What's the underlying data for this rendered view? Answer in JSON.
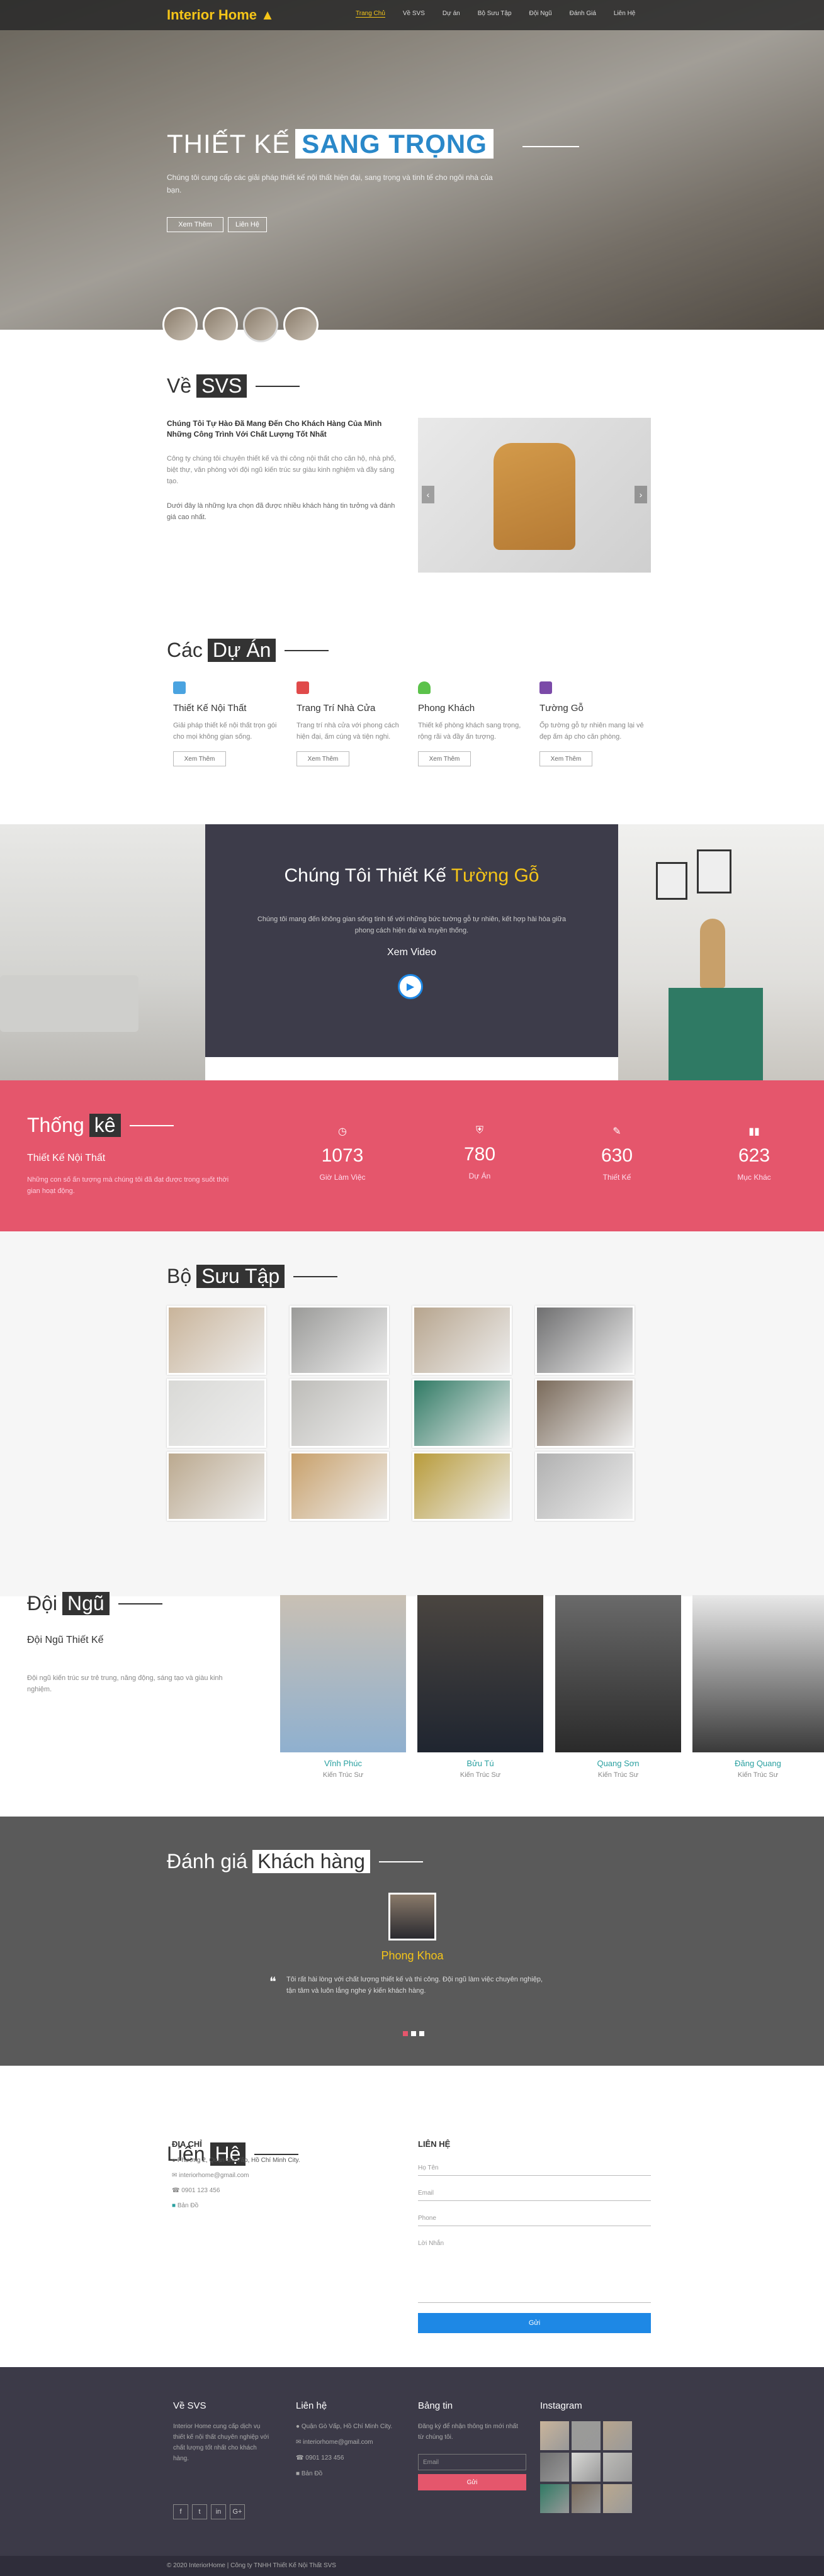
{
  "header": {
    "logo": "Interior Home",
    "nav": [
      "Trang Chủ",
      "Về SVS",
      "Dự án",
      "Bộ Sưu Tập",
      "Đội Ngũ",
      "Đánh Giá",
      "Liên Hệ"
    ]
  },
  "hero": {
    "title_plain": "THIẾT KẾ",
    "title_highlight": "SANG TRỌNG",
    "subtitle": "Chúng tôi cung cấp các giải pháp thiết kế nội thất hiện đại, sang trọng và tinh tế cho ngôi nhà của bạn.",
    "btn_more": "Xem Thêm",
    "btn_contact": "Liên Hệ"
  },
  "about": {
    "title_plain": "Về",
    "title_highlight": "SVS",
    "heading": "Chúng Tôi Tự Hào Đã Mang Đến Cho Khách Hàng Của Mình Những Công Trình Với Chất Lượng Tốt Nhất",
    "text1": "Công ty chúng tôi chuyên thiết kế và thi công nội thất cho căn hộ, nhà phố, biệt thự, văn phòng với đội ngũ kiến trúc sư giàu kinh nghiệm và đầy sáng tạo.",
    "text2": "Dưới đây là những lựa chọn đã được nhiều khách hàng tin tưởng và đánh giá cao nhất."
  },
  "projects": {
    "title_plain": "Các",
    "title_highlight": "Dự Án",
    "items": [
      {
        "title": "Thiết Kế Nội Thất",
        "text": "Giải pháp thiết kế nội thất trọn gói cho mọi không gian sống.",
        "btn": "Xem Thêm"
      },
      {
        "title": "Trang Trí Nhà Cửa",
        "text": "Trang trí nhà cửa với phong cách hiện đại, ấm cúng và tiện nghi.",
        "btn": "Xem Thêm"
      },
      {
        "title": "Phong Khách",
        "text": "Thiết kế phòng khách sang trọng, rộng rãi và đầy ấn tượng.",
        "btn": "Xem Thêm"
      },
      {
        "title": "Tường Gỗ",
        "text": "Ốp tường gỗ tự nhiên mang lại vẻ đẹp ấm áp cho căn phòng.",
        "btn": "Xem Thêm"
      }
    ]
  },
  "video": {
    "title_plain": "Chúng Tôi Thiết Kế",
    "title_highlight": "Tường Gỗ",
    "text": "Chúng tôi mang đến không gian sống tinh tế với những bức tường gỗ tự nhiên, kết hợp hài hòa giữa phong cách hiện đại và truyền thống.",
    "label": "Xem Video"
  },
  "stats": {
    "title_plain": "Thống",
    "title_highlight": "kê",
    "subtitle": "Thiết Kế Nội Thất",
    "text": "Những con số ấn tượng mà chúng tôi đã đạt được trong suốt thời gian hoạt động.",
    "items": [
      {
        "icon": "clock-icon",
        "value": "1073",
        "label": "Giờ Làm Việc"
      },
      {
        "icon": "shield-icon",
        "value": "780",
        "label": "Dự Án"
      },
      {
        "icon": "edit-icon",
        "value": "630",
        "label": "Thiết Kế"
      },
      {
        "icon": "barcode-icon",
        "value": "623",
        "label": "Mục Khác"
      }
    ]
  },
  "collection": {
    "title_plain": "Bộ",
    "title_highlight": "Sưu Tập",
    "colors": [
      "#c9b49a",
      "#9a9a98",
      "#b7a58e",
      "#6f6f70",
      "#d9d9d6",
      "#bdbcb8",
      "#2f7a64",
      "#7a6a5a",
      "#bba98f",
      "#c8a06a",
      "#b89b3a",
      "#b0b0b0"
    ]
  },
  "team": {
    "title_plain": "Đội",
    "title_highlight": "Ngũ",
    "subtitle": "Đội Ngũ Thiết Kế",
    "text": "Đội ngũ kiến trúc sư trẻ trung, năng động, sáng tạo và giàu kinh nghiệm.",
    "members": [
      {
        "name": "Vĩnh Phúc",
        "role": "Kiến Trúc Sư"
      },
      {
        "name": "Bửu Tú",
        "role": "Kiến Trúc Sư"
      },
      {
        "name": "Quang Sơn",
        "role": "Kiến Trúc Sư"
      },
      {
        "name": "Đăng Quang",
        "role": "Kiến Trúc Sư"
      }
    ]
  },
  "testimonial": {
    "title_plain": "Đánh giá",
    "title_highlight": "Khách hàng",
    "name": "Phong Khoa",
    "quote": "Tôi rất hài lòng với chất lượng thiết kế và thi công. Đội ngũ làm việc chuyên nghiệp, tận tâm và luôn lắng nghe ý kiến khách hàng."
  },
  "contact": {
    "title_plain": "Liên",
    "title_highlight": "Hệ",
    "address_heading": "ĐỊA CHỈ",
    "address": "Phường 2, Quận Gò Vấp, Hồ Chí Minh City.",
    "email": "interiorhome@gmail.com",
    "phone": "0901 123 456",
    "map": "Bản Đồ",
    "form_heading": "LIÊN HỆ",
    "name_ph": "Họ Tên",
    "email_ph": "Email",
    "phone_ph": "Phone",
    "msg_ph": "Lời Nhắn",
    "submit": "Gửi"
  },
  "footer": {
    "about_heading": "Về SVS",
    "about_text": "Interior Home cung cấp dịch vụ thiết kế nội thất chuyên nghiệp với chất lượng tốt nhất cho khách hàng.",
    "contact_heading": "Liên hệ",
    "contact_items": [
      "Quận Gò Vấp, Hồ Chí Minh City.",
      "interiorhome@gmail.com",
      "0901 123 456",
      "Bản Đồ"
    ],
    "news_heading": "Bảng tin",
    "news_text": "Đăng ký để nhận thông tin mới nhất từ chúng tôi.",
    "news_ph": "Email",
    "news_btn": "Gửi",
    "insta_heading": "Instagram",
    "social": [
      "f",
      "t",
      "in",
      "G+"
    ],
    "copyright": "© 2020 InteriorHome | Công ty TNHH Thiết Kế Nội Thất SVS"
  }
}
